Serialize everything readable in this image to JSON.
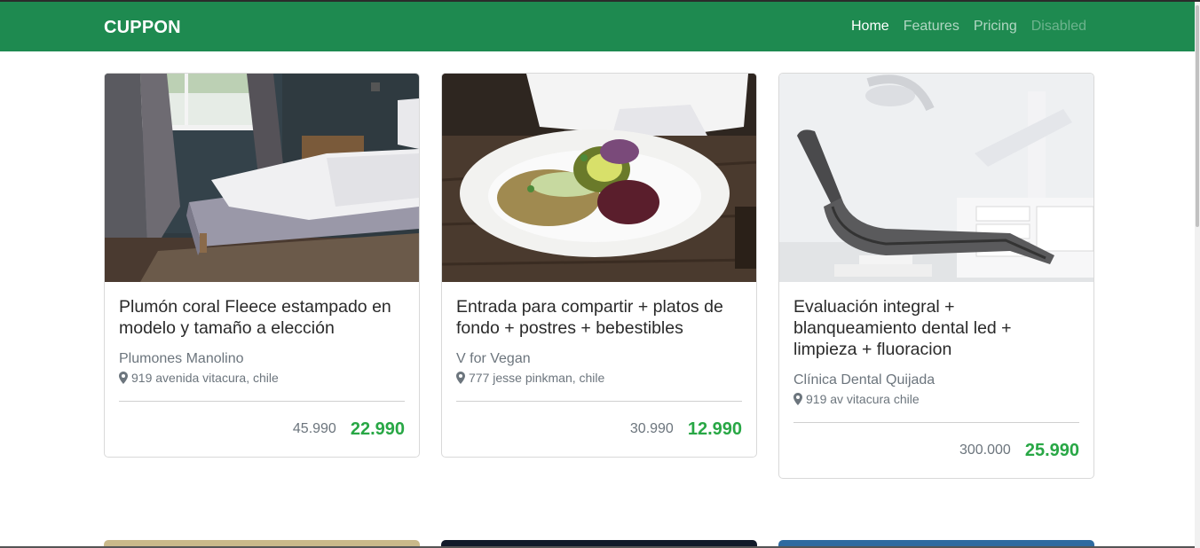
{
  "brand": "CUPPON",
  "nav": {
    "home": "Home",
    "features": "Features",
    "pricing": "Pricing",
    "disabled": "Disabled"
  },
  "colors": {
    "navbar": "#1e8a50",
    "price_new": "#28a745"
  },
  "cards": [
    {
      "title": "Plumón coral Fleece estampado en modelo y tamaño a elección",
      "merchant": "Plumones Manolino",
      "address": "919 avenida vitacura, chile",
      "old_price": "45.990",
      "new_price": "22.990"
    },
    {
      "title": "Entrada para compartir + platos de fondo + postres + bebestibles",
      "merchant": "V for Vegan",
      "address": "777 jesse pinkman, chile",
      "old_price": "30.990",
      "new_price": "12.990"
    },
    {
      "title": "Evaluación integral + blanqueamiento dental led + limpieza + fluoracion",
      "merchant": "Clínica Dental Quijada",
      "address": "919 av vitacura chile",
      "old_price": "300.000",
      "new_price": "25.990"
    }
  ]
}
